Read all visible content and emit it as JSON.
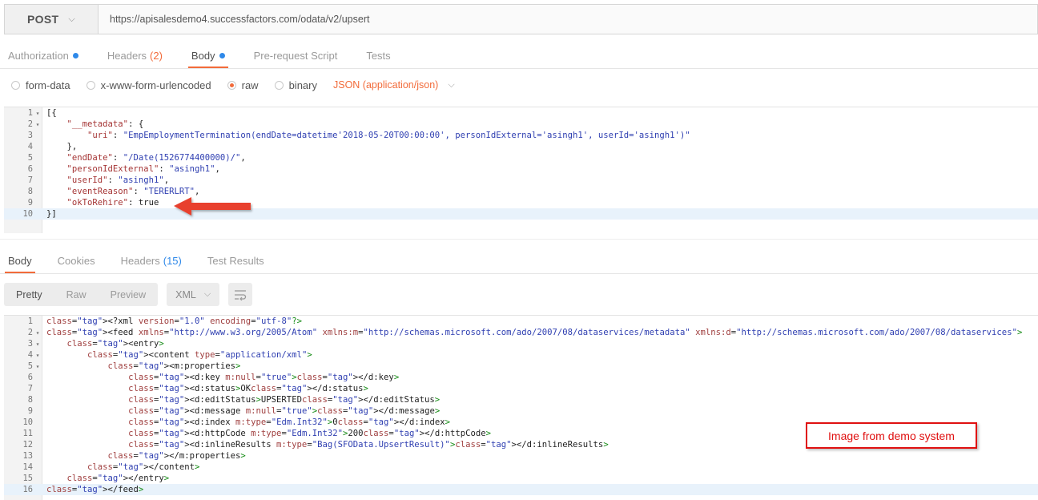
{
  "request": {
    "method": "POST",
    "url": "https://apisalesdemo4.successfactors.com/odata/v2/upsert"
  },
  "request_tabs": [
    {
      "label": "Authorization",
      "count": "",
      "dot": true,
      "active": false
    },
    {
      "label": "Headers",
      "count": "(2)",
      "dot": false,
      "active": false
    },
    {
      "label": "Body",
      "count": "",
      "dot": true,
      "active": true
    },
    {
      "label": "Pre-request Script",
      "count": "",
      "dot": false,
      "active": false
    },
    {
      "label": "Tests",
      "count": "",
      "dot": false,
      "active": false
    }
  ],
  "body_modes": [
    {
      "label": "form-data",
      "checked": false
    },
    {
      "label": "x-www-form-urlencoded",
      "checked": false
    },
    {
      "label": "raw",
      "checked": true
    },
    {
      "label": "binary",
      "checked": false
    }
  ],
  "content_type": "JSON (application/json)",
  "request_body": [
    {
      "n": "1",
      "fold": "-",
      "text": "[{"
    },
    {
      "n": "2",
      "fold": "-",
      "text": "    \"__metadata\": {"
    },
    {
      "n": "3",
      "fold": "",
      "text": "        \"uri\": \"EmpEmploymentTermination(endDate=datetime'2018-05-20T00:00:00', personIdExternal='asingh1', userId='asingh1')\""
    },
    {
      "n": "4",
      "fold": "",
      "text": "    },"
    },
    {
      "n": "5",
      "fold": "",
      "text": "    \"endDate\": \"/Date(1526774400000)/\","
    },
    {
      "n": "6",
      "fold": "",
      "text": "    \"personIdExternal\": \"asingh1\","
    },
    {
      "n": "7",
      "fold": "",
      "text": "    \"userId\": \"asingh1\","
    },
    {
      "n": "8",
      "fold": "",
      "text": "    \"eventReason\": \"TERERLRT\","
    },
    {
      "n": "9",
      "fold": "",
      "text": "    \"okToRehire\": true"
    },
    {
      "n": "10",
      "fold": "",
      "text": "}]"
    }
  ],
  "response_tabs": [
    {
      "label": "Body",
      "count": "",
      "active": true
    },
    {
      "label": "Cookies",
      "count": "",
      "active": false
    },
    {
      "label": "Headers",
      "count": "(15)",
      "active": false
    },
    {
      "label": "Test Results",
      "count": "",
      "active": false
    }
  ],
  "view_modes": [
    "Pretty",
    "Raw",
    "Preview"
  ],
  "response_format": "XML",
  "response_body": [
    {
      "n": "1",
      "fold": "",
      "text": "<?xml version=\"1.0\" encoding=\"utf-8\"?>"
    },
    {
      "n": "2",
      "fold": "-",
      "text": "<feed xmlns=\"http://www.w3.org/2005/Atom\" xmlns:m=\"http://schemas.microsoft.com/ado/2007/08/dataservices/metadata\" xmlns:d=\"http://schemas.microsoft.com/ado/2007/08/dataservices\">"
    },
    {
      "n": "3",
      "fold": "-",
      "text": "    <entry>"
    },
    {
      "n": "4",
      "fold": "-",
      "text": "        <content type=\"application/xml\">"
    },
    {
      "n": "5",
      "fold": "-",
      "text": "            <m:properties>"
    },
    {
      "n": "6",
      "fold": "",
      "text": "                <d:key m:null=\"true\"></d:key>"
    },
    {
      "n": "7",
      "fold": "",
      "text": "                <d:status>OK</d:status>"
    },
    {
      "n": "8",
      "fold": "",
      "text": "                <d:editStatus>UPSERTED</d:editStatus>"
    },
    {
      "n": "9",
      "fold": "",
      "text": "                <d:message m:null=\"true\"></d:message>"
    },
    {
      "n": "10",
      "fold": "",
      "text": "                <d:index m:type=\"Edm.Int32\">0</d:index>"
    },
    {
      "n": "11",
      "fold": "",
      "text": "                <d:httpCode m:type=\"Edm.Int32\">200</d:httpCode>"
    },
    {
      "n": "12",
      "fold": "",
      "text": "                <d:inlineResults m:type=\"Bag(SFOData.UpsertResult)\"></d:inlineResults>"
    },
    {
      "n": "13",
      "fold": "",
      "text": "            </m:properties>"
    },
    {
      "n": "14",
      "fold": "",
      "text": "        </content>"
    },
    {
      "n": "15",
      "fold": "",
      "text": "    </entry>"
    },
    {
      "n": "16",
      "fold": "",
      "text": "</feed>"
    }
  ],
  "annotation": {
    "text": "Image from demo system",
    "color": "#e01010"
  },
  "colors": {
    "accent": "#f26b3a",
    "dot": "#2f89e9",
    "highlight_line": "#e8f2fb"
  },
  "icons": {
    "method_dropdown": "chevron-down-icon",
    "content_type_dropdown": "chevron-down-icon",
    "format_dropdown": "chevron-down-icon",
    "wrap": "wrap-lines-icon",
    "annotation_arrow": "red-arrow-icon"
  }
}
